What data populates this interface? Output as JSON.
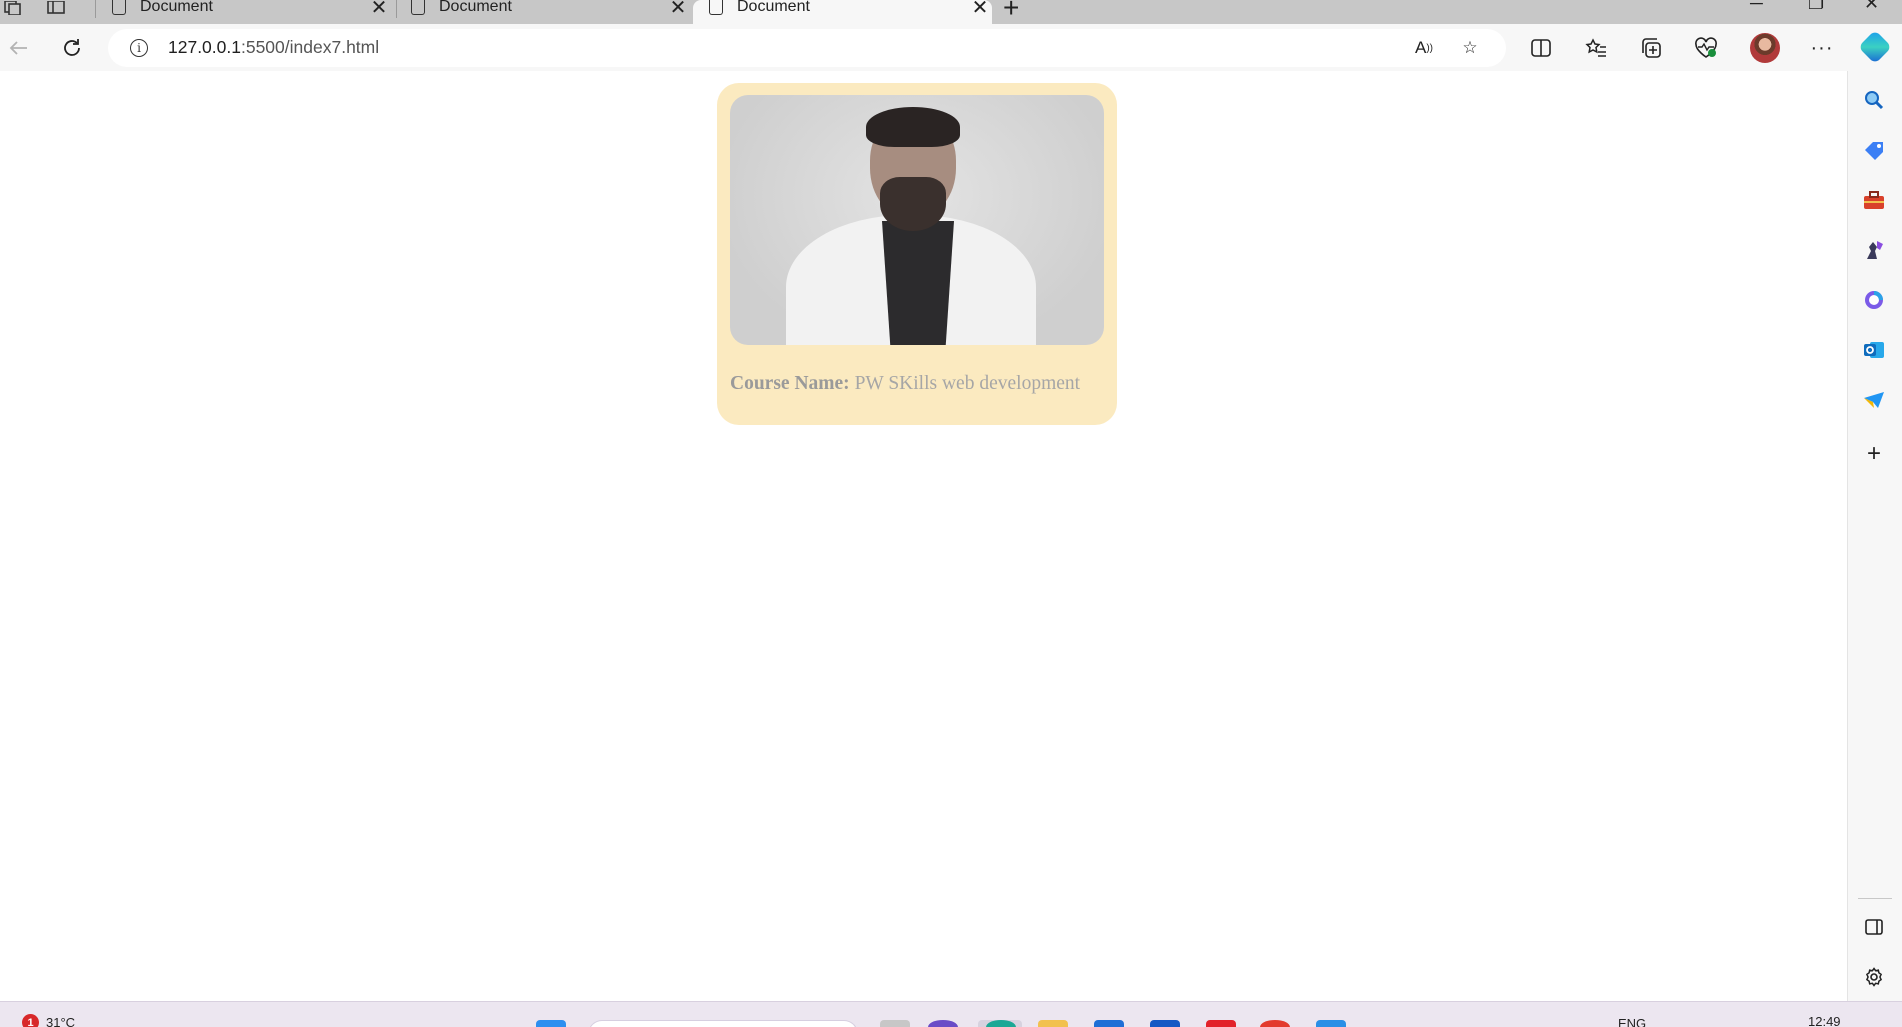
{
  "tabs": [
    {
      "title": "Document",
      "active": false
    },
    {
      "title": "Document",
      "active": false
    },
    {
      "title": "Document",
      "active": true
    }
  ],
  "toolbar": {
    "url_host": "127.0.0.1",
    "url_rest": ":5500/index7.html"
  },
  "card": {
    "label": "Course Name:",
    "value": "PW SKills web development",
    "background": "#fbeac0"
  },
  "taskbar": {
    "notification_count": "1",
    "temperature": "31°C",
    "language": "ENG",
    "time": "12:49"
  },
  "icons": {
    "tab_strip": [
      "workspaces-icon",
      "vertical-tabs-icon"
    ],
    "toolbar": [
      "back-icon",
      "refresh-icon",
      "info-icon",
      "read-aloud-icon",
      "favorite-star-icon",
      "split-screen-icon",
      "favorites-icon",
      "collections-icon",
      "browser-essentials-icon",
      "profile-avatar",
      "more-icon",
      "copilot-icon"
    ],
    "sidebar": [
      "search-icon",
      "shopping-icon",
      "tools-icon",
      "games-icon",
      "microsoft365-icon",
      "outlook-icon",
      "send-icon",
      "add-icon",
      "sidebar-toggle-icon",
      "settings-icon"
    ]
  }
}
